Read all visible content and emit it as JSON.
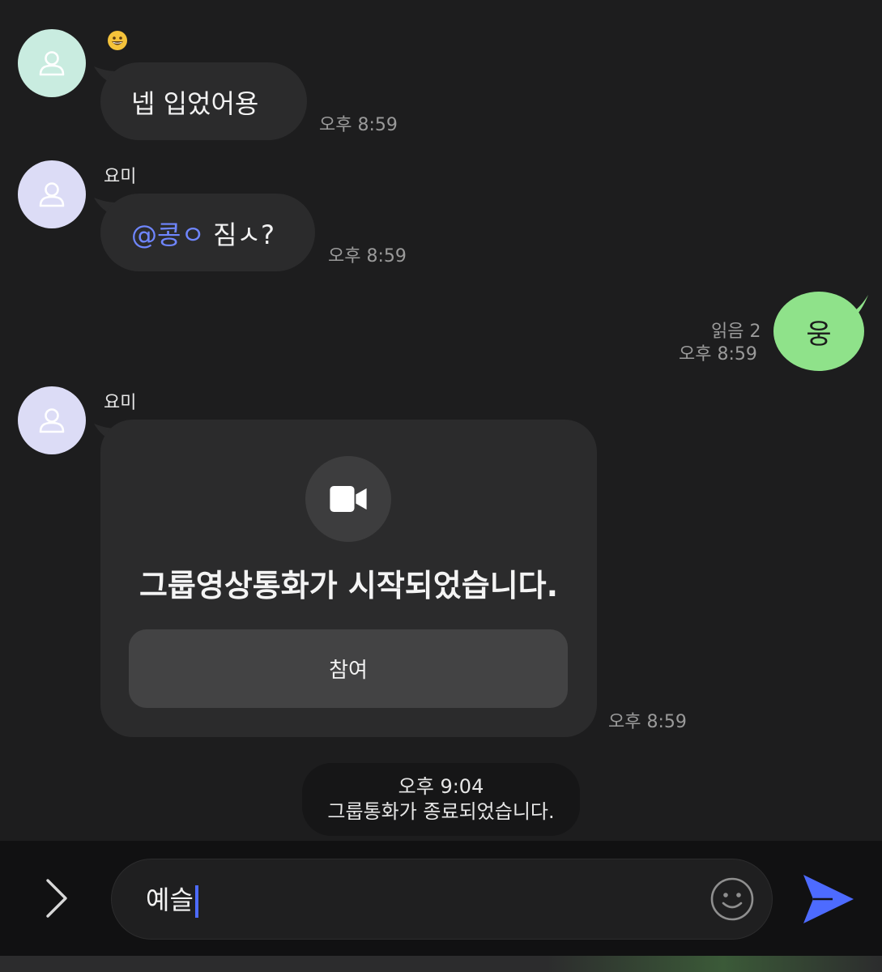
{
  "messages": [
    {
      "sender": "",
      "reaction_icon": "grinning-face-emoji",
      "text": "넵 입었어용",
      "time": "오후 8:59",
      "avatar_color": "#c9ece0"
    },
    {
      "sender": "요미",
      "mention": "@콩ㅇ",
      "text": " 짐ㅅ?",
      "time": "오후 8:59",
      "avatar_color": "#dcdcf6"
    },
    {
      "sender": "",
      "text": "웅",
      "read": "읽음 2",
      "time": "오후 8:59"
    },
    {
      "sender": "요미",
      "card_title": "그룹영상통화가 시작되었습니다.",
      "join_label": "참여",
      "time": "오후 8:59",
      "avatar_color": "#dcdcf6",
      "icon": "video-camera-icon"
    }
  ],
  "notice": {
    "time": "오후 9:04",
    "text": "그룹통화가 종료되었습니다."
  },
  "composer": {
    "value": "예슬",
    "expand_icon": "chevron-right-icon",
    "emoji_icon": "smiley-icon",
    "send_icon": "send-arrow-icon",
    "send_color": "#4d6bff"
  },
  "colors": {
    "background": "#1d1d1e",
    "bubble": "#2b2b2c",
    "mine_bubble": "#8fe28a",
    "mention": "#6f86ff"
  }
}
